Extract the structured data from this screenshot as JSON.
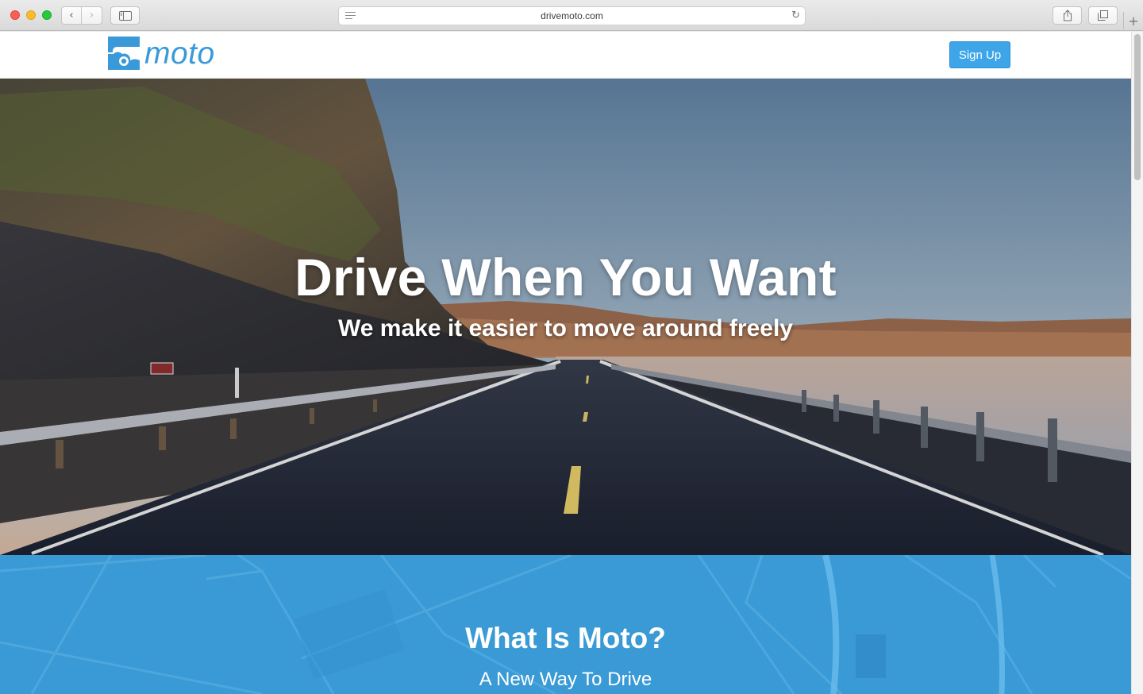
{
  "browser": {
    "url": "drivemoto.com",
    "icons": {
      "back": "chevron-left-icon",
      "forward": "chevron-right-icon",
      "sidebar": "sidebar-icon",
      "reader": "reader-list-icon",
      "reload": "reload-icon",
      "share": "share-icon",
      "tabs": "tabs-overview-icon",
      "new_tab": "plus-icon"
    },
    "glyphs": {
      "back": "‹",
      "forward": "›",
      "reload": "↻",
      "share": "⇪",
      "tabs": "⧉",
      "new_tab": "+"
    }
  },
  "site": {
    "logo_text": "moto",
    "signup_label": "Sign Up",
    "hero": {
      "title": "Drive When You Want",
      "subtitle": "We make it easier to move around freely"
    },
    "about": {
      "title": "What Is Moto?",
      "subtitle": "A New Way To Drive"
    }
  },
  "colors": {
    "brand_blue": "#3a9ad9",
    "button_blue": "#3da5e8",
    "section_blue": "#3a9ad5"
  }
}
